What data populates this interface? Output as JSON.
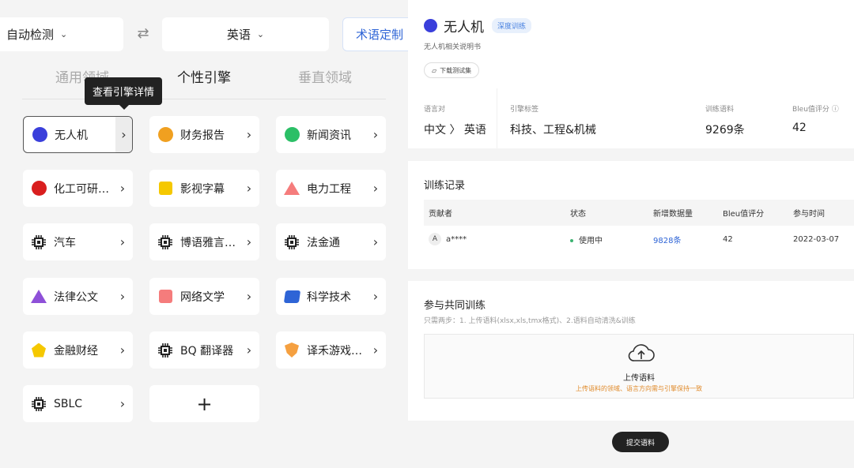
{
  "left": {
    "source_lang": "自动检测",
    "target_lang": "英语",
    "term_button": "术语定制",
    "tabs": [
      "通用领域",
      "个性引擎",
      "垂直领域"
    ],
    "tooltip": "查看引擎详情",
    "engines": [
      {
        "label": "无人机",
        "icon": "circle",
        "color": "#3a3fdb",
        "selected": true
      },
      {
        "label": "财务报告",
        "icon": "circle",
        "color": "#f0a020"
      },
      {
        "label": "新闻资讯",
        "icon": "circle",
        "color": "#2bbf66"
      },
      {
        "label": "化工可研…",
        "icon": "circle",
        "color": "#d91e1e"
      },
      {
        "label": "影视字幕",
        "icon": "square",
        "color": "#f5c800"
      },
      {
        "label": "电力工程",
        "icon": "triangle",
        "color": "#f57c7c"
      },
      {
        "label": "汽车",
        "icon": "chip",
        "color": "#222222"
      },
      {
        "label": "博语雅言…",
        "icon": "chip",
        "color": "#222222"
      },
      {
        "label": "法金通",
        "icon": "chip",
        "color": "#222222"
      },
      {
        "label": "法律公文",
        "icon": "triangle",
        "color": "#8e50d8"
      },
      {
        "label": "网络文学",
        "icon": "square",
        "color": "#f57c7c"
      },
      {
        "label": "科学技术",
        "icon": "trapezoid",
        "color": "#2e64d6"
      },
      {
        "label": "金融财经",
        "icon": "pentagon",
        "color": "#f5c800"
      },
      {
        "label": "BQ 翻译器",
        "icon": "chip",
        "color": "#222222"
      },
      {
        "label": "译禾游戏…",
        "icon": "shield",
        "color": "#f5a040"
      },
      {
        "label": "SBLC",
        "icon": "chip",
        "color": "#222222"
      }
    ]
  },
  "detail": {
    "name": "无人机",
    "badge": "深度训练",
    "description": "无人机相关说明书",
    "download_label": "下载测试集",
    "stats": [
      {
        "label": "语言对",
        "value": "中文 〉 英语"
      },
      {
        "label": "引擎标签",
        "value": "科技、工程&机械"
      },
      {
        "label": "训练语料",
        "value": "9269条"
      },
      {
        "label": "Bleu值评分 ⓘ",
        "value": "42"
      }
    ]
  },
  "records": {
    "title": "训练记录",
    "columns": [
      "贡献者",
      "状态",
      "新增数据量",
      "Bleu值评分",
      "参与时间"
    ],
    "rows": [
      {
        "avatar": "A",
        "contributor": "a****",
        "status": "使用中",
        "amount": "9828条",
        "bleu": "42",
        "time": "2022-03-07"
      }
    ]
  },
  "cotrain": {
    "title": "参与共同训练",
    "hint": "只需两步：1. 上传语料(xlsx,xls,tmx格式)、2.语料自动清洗&训练",
    "upload_title": "上传语料",
    "upload_sub": "上传语料的领域、语言方向需与引擎保持一致",
    "submit_label": "提交语料"
  }
}
